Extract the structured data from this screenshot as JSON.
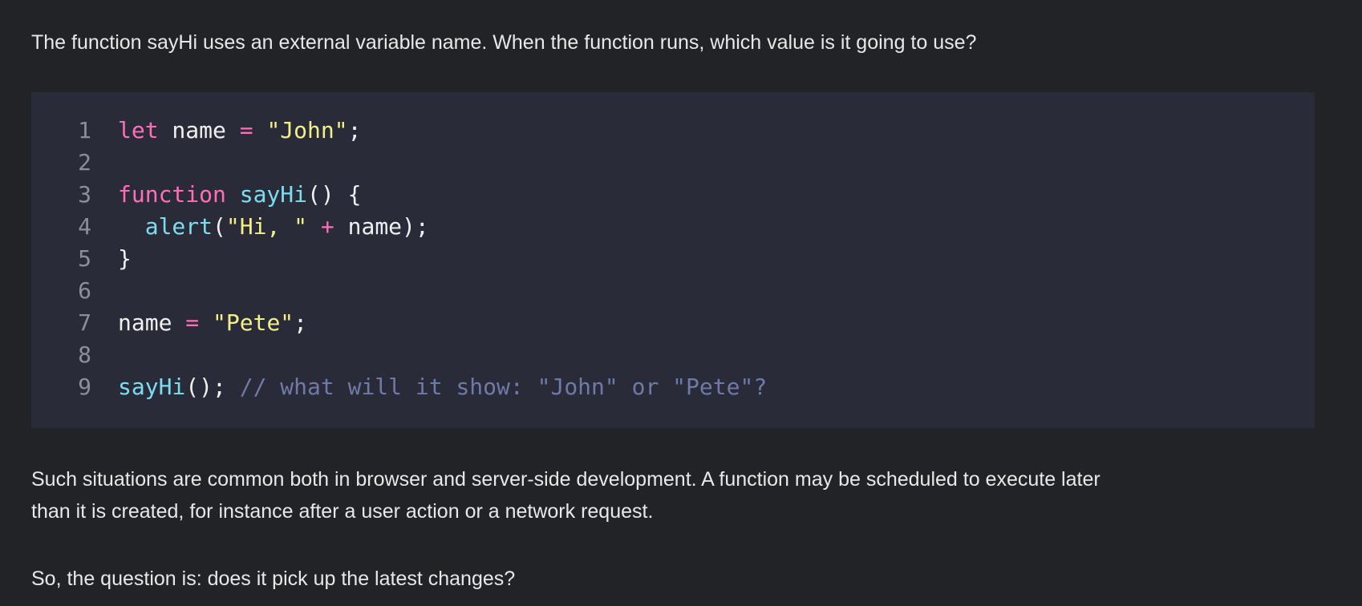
{
  "intro": "The function sayHi uses an external variable name. When the function runs, which value is it going to use?",
  "code": {
    "lines": [
      {
        "num": "1",
        "tokens": [
          {
            "t": "let",
            "c": "kw"
          },
          {
            "t": " name ",
            "c": "pl"
          },
          {
            "t": "=",
            "c": "op"
          },
          {
            "t": " ",
            "c": "pl"
          },
          {
            "t": "\"John\"",
            "c": "str"
          },
          {
            "t": ";",
            "c": "pl"
          }
        ]
      },
      {
        "num": "2",
        "tokens": []
      },
      {
        "num": "3",
        "tokens": [
          {
            "t": "function",
            "c": "kw"
          },
          {
            "t": " ",
            "c": "pl"
          },
          {
            "t": "sayHi",
            "c": "fn"
          },
          {
            "t": "() {",
            "c": "pl"
          }
        ]
      },
      {
        "num": "4",
        "tokens": [
          {
            "t": "  ",
            "c": "pl"
          },
          {
            "t": "alert",
            "c": "fn"
          },
          {
            "t": "(",
            "c": "pl"
          },
          {
            "t": "\"Hi, \"",
            "c": "str"
          },
          {
            "t": " ",
            "c": "pl"
          },
          {
            "t": "+",
            "c": "op"
          },
          {
            "t": " name);",
            "c": "pl"
          }
        ]
      },
      {
        "num": "5",
        "tokens": [
          {
            "t": "}",
            "c": "pl"
          }
        ]
      },
      {
        "num": "6",
        "tokens": []
      },
      {
        "num": "7",
        "tokens": [
          {
            "t": "name ",
            "c": "pl"
          },
          {
            "t": "=",
            "c": "op"
          },
          {
            "t": " ",
            "c": "pl"
          },
          {
            "t": "\"Pete\"",
            "c": "str"
          },
          {
            "t": ";",
            "c": "pl"
          }
        ]
      },
      {
        "num": "8",
        "tokens": []
      },
      {
        "num": "9",
        "tokens": [
          {
            "t": "sayHi",
            "c": "fn"
          },
          {
            "t": "(); ",
            "c": "pl"
          },
          {
            "t": "// what will it show: \"John\" or \"Pete\"?",
            "c": "cm"
          }
        ]
      }
    ]
  },
  "para2": {
    "line1": "Such situations are common both in browser and server-side development. A function may be scheduled to execute later",
    "line2": "than it is created, for instance after a user action or a network request."
  },
  "para3": "So, the question is: does it pick up the latest changes?"
}
